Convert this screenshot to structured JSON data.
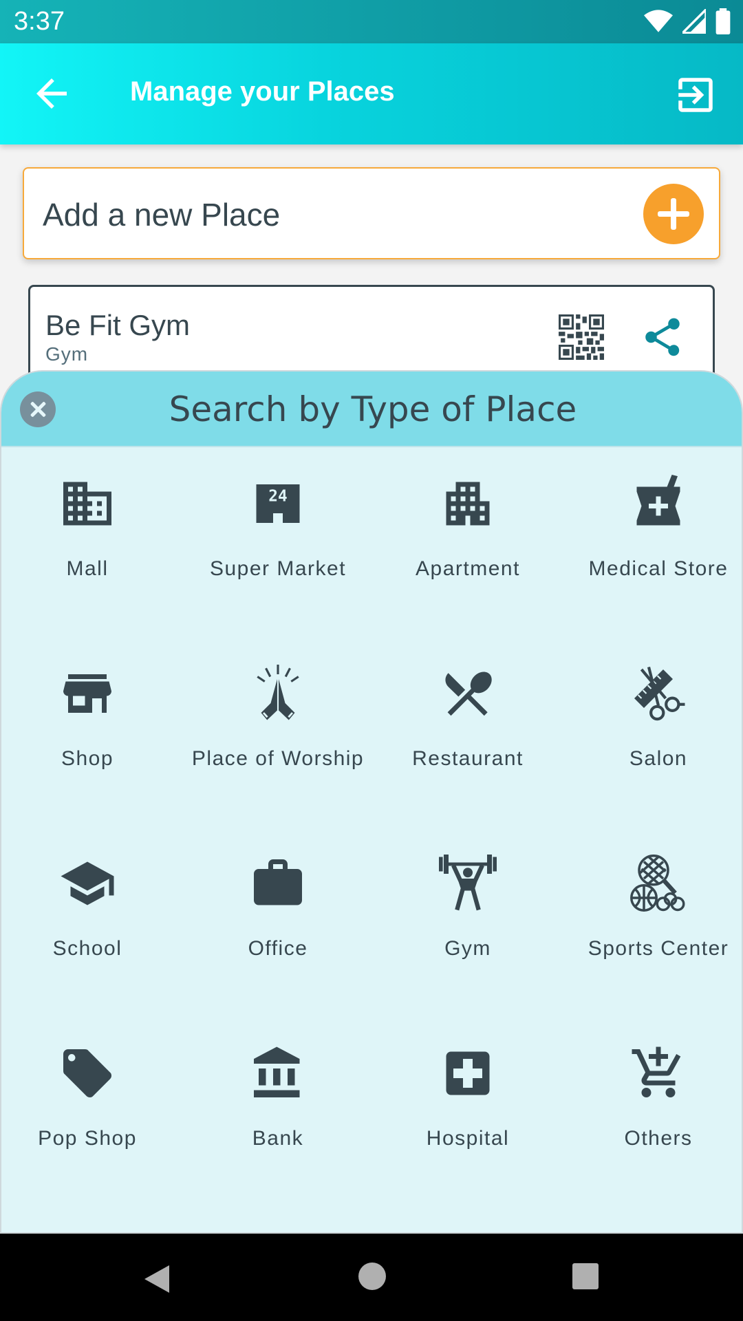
{
  "status_bar": {
    "time": "3:37"
  },
  "app_bar": {
    "title": "Manage your Places"
  },
  "add_place": {
    "label": "Add a new Place"
  },
  "place_card": {
    "name": "Be Fit Gym",
    "type": "Gym"
  },
  "sheet": {
    "title": "Search by Type of Place",
    "items": [
      {
        "label": "Mall",
        "icon": "building-icon"
      },
      {
        "label": "Super Market",
        "icon": "store-24-icon"
      },
      {
        "label": "Apartment",
        "icon": "apartment-icon"
      },
      {
        "label": "Medical Store",
        "icon": "medical-store-icon"
      },
      {
        "label": "Shop",
        "icon": "storefront-icon"
      },
      {
        "label": "Place of Worship",
        "icon": "praying-hands-icon"
      },
      {
        "label": "Restaurant",
        "icon": "utensils-icon"
      },
      {
        "label": "Salon",
        "icon": "scissors-comb-icon"
      },
      {
        "label": "School",
        "icon": "graduation-cap-icon"
      },
      {
        "label": "Office",
        "icon": "briefcase-icon"
      },
      {
        "label": "Gym",
        "icon": "weightlifter-icon"
      },
      {
        "label": "Sports Center",
        "icon": "sports-balls-icon"
      },
      {
        "label": "Pop Shop",
        "icon": "price-tag-icon"
      },
      {
        "label": "Bank",
        "icon": "bank-icon"
      },
      {
        "label": "Hospital",
        "icon": "hospital-cross-icon"
      },
      {
        "label": "Others",
        "icon": "cart-plus-icon"
      }
    ]
  },
  "colors": {
    "primary": "#08d3dd",
    "accent": "#f7a02c",
    "icon": "#37474f",
    "sheet_bg": "#dff5f8",
    "sheet_header": "#7fdce8"
  }
}
